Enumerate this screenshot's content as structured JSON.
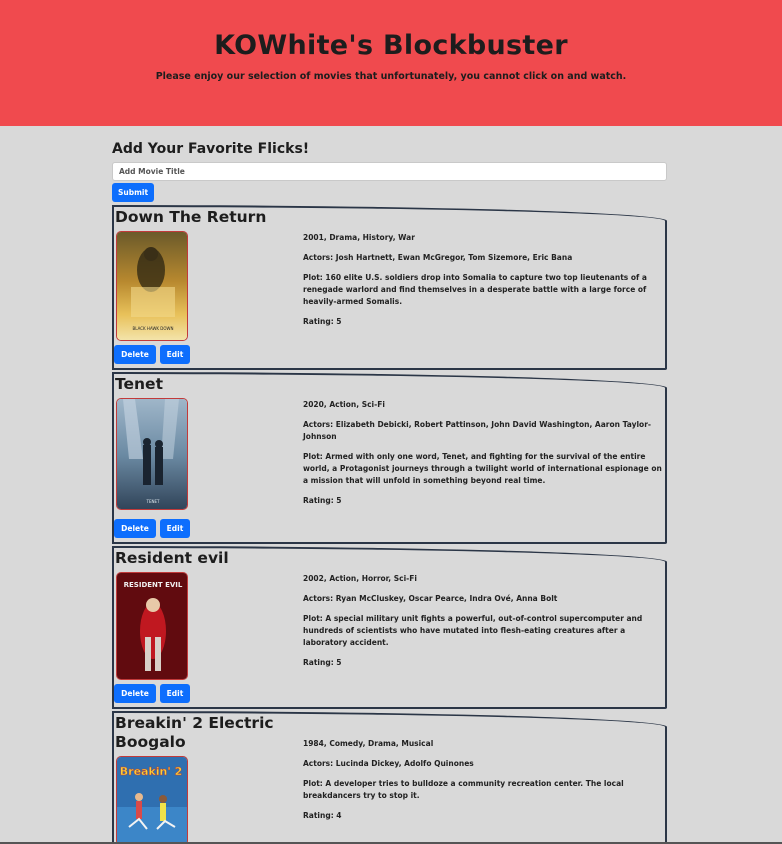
{
  "header": {
    "title": "KOWhite's Blockbuster",
    "subtitle": "Please enjoy our selection of movies that unfortunately, you cannot click on and watch."
  },
  "form": {
    "heading": "Add Your Favorite Flicks!",
    "placeholder": "Add Movie Title",
    "submit_label": "Submit"
  },
  "buttons": {
    "delete_label": "Delete",
    "edit_label": "Edit"
  },
  "colors": {
    "header_bg": "#f04a4e",
    "button": "#0d6efd",
    "page_bg": "#d9d9d9",
    "card_border": "#2b3647"
  },
  "movies": [
    {
      "title": "Down The Return",
      "meta": "2001, Drama, History, War",
      "actors": "Actors: Josh Hartnett, Ewan McGregor, Tom Sizemore, Eric Bana",
      "plot": "Plot: 160 elite U.S. soldiers drop into Somalia to capture two top lieutenants of a renegade warlord and find themselves in a desperate battle with a large force of heavily-armed Somalis.",
      "rating": "Rating: 5",
      "poster_caption": "BLACK HAWK DOWN"
    },
    {
      "title": "Tenet",
      "meta": "2020, Action, Sci-Fi",
      "actors": "Actors: Elizabeth Debicki, Robert Pattinson, John David Washington, Aaron Taylor-Johnson",
      "plot": "Plot: Armed with only one word, Tenet, and fighting for the survival of the entire world, a Protagonist journeys through a twilight world of international espionage on a mission that will unfold in something beyond real time.",
      "rating": "Rating: 5",
      "poster_caption": "TENET"
    },
    {
      "title": "Resident evil",
      "meta": "2002, Action, Horror, Sci-Fi",
      "actors": "Actors: Ryan McCluskey, Oscar Pearce, Indra Ové, Anna Bolt",
      "plot": "Plot: A special military unit fights a powerful, out-of-control supercomputer and hundreds of scientists who have mutated into flesh-eating creatures after a laboratory accident.",
      "rating": "Rating: 5",
      "poster_caption": "RESIDENT EVIL"
    },
    {
      "title": "Breakin' 2 Electric Boogalo",
      "meta": "1984, Comedy, Drama, Musical",
      "actors": "Actors: Lucinda Dickey, Adolfo Quinones",
      "plot": "Plot: A developer tries to bulldoze a community recreation center. The local breakdancers try to stop it.",
      "rating": "Rating: 4",
      "poster_caption": "Breakin' 2"
    }
  ]
}
